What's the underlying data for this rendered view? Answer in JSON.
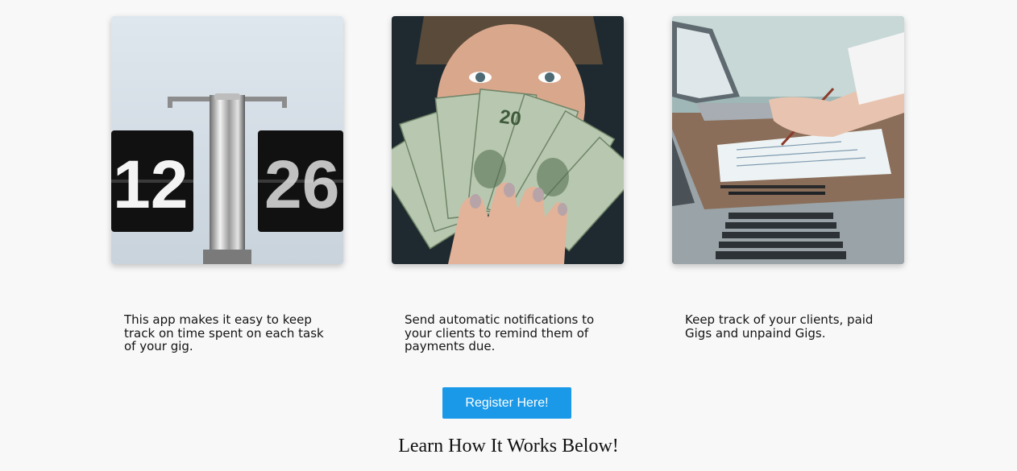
{
  "features": [
    {
      "image_icon": "flip-clock-photo",
      "clock_hours": "12",
      "clock_minutes": "26",
      "description": "This app makes it easy to keep track on time spent on each task of your gig."
    },
    {
      "image_icon": "cash-fan-photo",
      "bill_value": "20",
      "description": "Send automatic notifications to your clients to remind them of payments due."
    },
    {
      "image_icon": "laptop-desk-photo",
      "description": "Keep track of your clients, paid Gigs and unpaind Gigs."
    }
  ],
  "register_button_label": "Register Here!",
  "learn_heading": "Learn How It Works Below!",
  "colors": {
    "background": "#f8f8f8",
    "button": "#1a99e8",
    "button_text": "#ffffff"
  }
}
